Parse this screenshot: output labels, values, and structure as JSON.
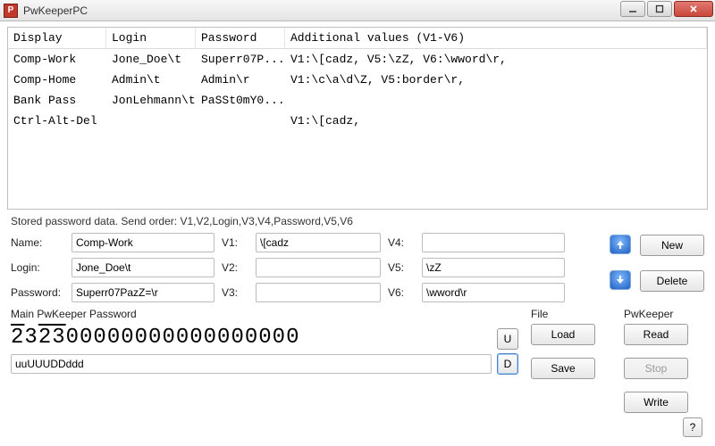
{
  "window": {
    "title": "PwKeeperPC"
  },
  "table": {
    "headers": {
      "display": "Display",
      "login": "Login",
      "password": "Password",
      "additional": "Additional values (V1-V6)"
    },
    "rows": [
      {
        "display": "Comp-Work",
        "login": "Jone_Doe\\t",
        "password": "Superr07P...",
        "additional": "V1:\\[cadz, V5:\\zZ, V6:\\wword\\r,"
      },
      {
        "display": "Comp-Home",
        "login": "Admin\\t",
        "password": "Admin\\r",
        "additional": "V1:\\c\\a\\d\\Z, V5:border\\r,"
      },
      {
        "display": "Bank Pass",
        "login": "JonLehmann\\t",
        "password": "PaSSt0mY0...",
        "additional": ""
      },
      {
        "display": "Ctrl-Alt-Del",
        "login": "",
        "password": "",
        "additional": "V1:\\[cadz,"
      }
    ]
  },
  "hint": "Stored password data. Send order: V1,V2,Login,V3,V4,Password,V5,V6",
  "form": {
    "labels": {
      "name": "Name:",
      "login": "Login:",
      "password": "Password:",
      "v1": "V1:",
      "v2": "V2:",
      "v3": "V3:",
      "v4": "V4:",
      "v5": "V5:",
      "v6": "V6:"
    },
    "values": {
      "name": "Comp-Work",
      "login": "Jone_Doe\\t",
      "password": "Superr07PazZ=\\r",
      "v1": "\\[cadz",
      "v2": "",
      "v3": "",
      "v4": "",
      "v5": "\\zZ",
      "v6": "\\wword\\r"
    }
  },
  "buttons": {
    "new": "New",
    "delete": "Delete",
    "load": "Load",
    "save": "Save",
    "read": "Read",
    "stop": "Stop",
    "write": "Write",
    "u": "U",
    "d": "D",
    "help": "?"
  },
  "groups": {
    "mainpw": "Main PwKeeper Password",
    "file": "File",
    "pwkeeper": "PwKeeper"
  },
  "mainpw": {
    "code_html": "<span class='ov'>2</span>3<span class='ov'>2</span><span class='ov'>3</span>00000000000000000",
    "input": "uuUUUDDddd"
  }
}
